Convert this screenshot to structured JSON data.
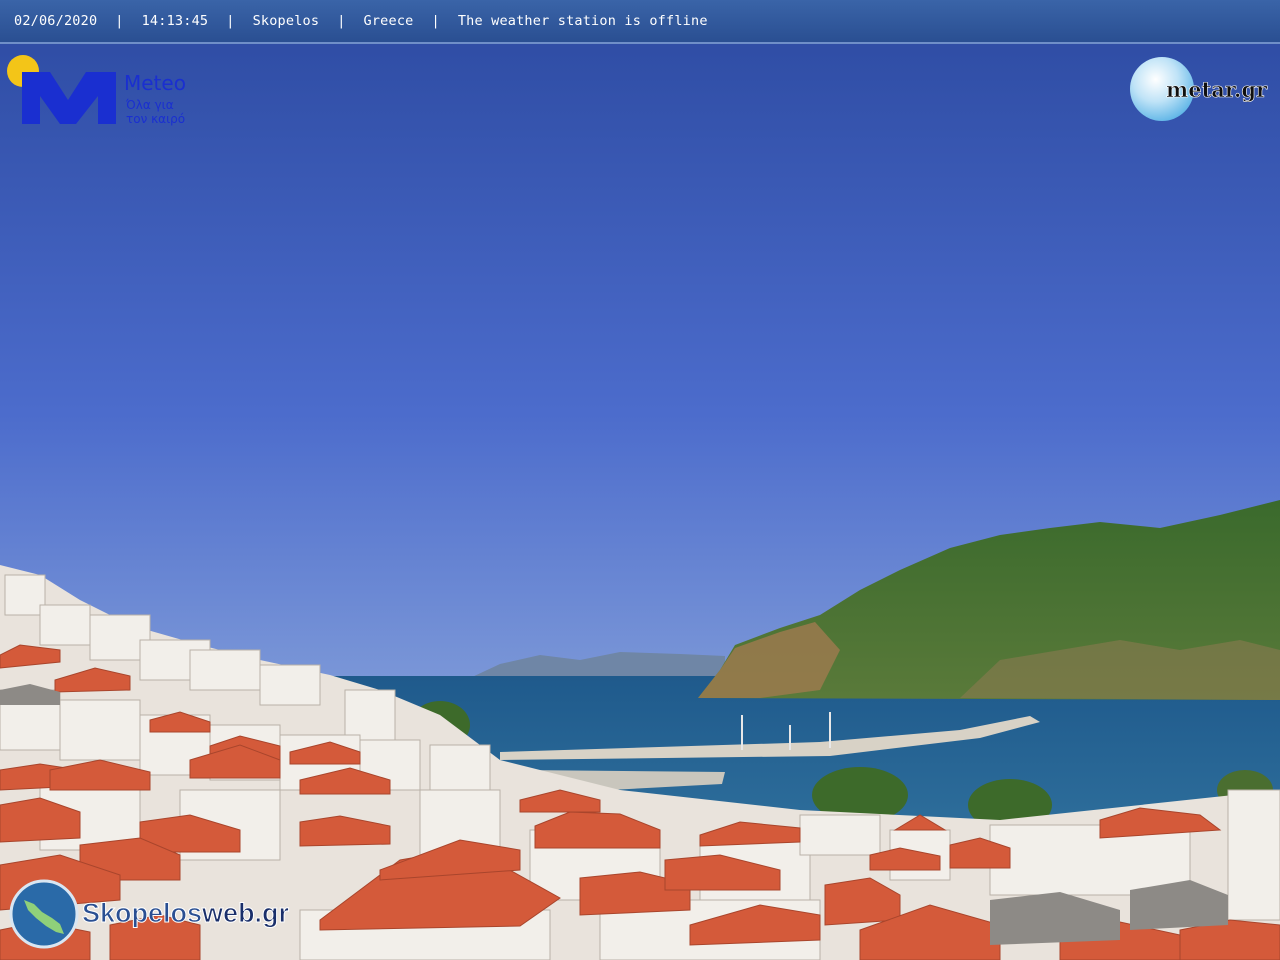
{
  "status_bar": {
    "date": "02/06/2020",
    "time": "14:13:45",
    "place": "Skopelos",
    "country": "Greece",
    "message": "The weather station is offline",
    "separator": "|"
  },
  "logos": {
    "meteo_brand": "Meteo",
    "meteo_tagline_1": "Όλα για",
    "meteo_tagline_2": "τον καιρό",
    "metar_brand": "metar.gr",
    "skopelos_brand_1": "Skopelos",
    "skopelos_brand_2": "web.gr"
  },
  "colors": {
    "sky_top": "#2f4fa6",
    "sky_bottom": "#6f8fd8",
    "sea": "#2c6a9a",
    "hill": "#3f6e2e",
    "roof": "#d45a3a",
    "meteo_blue": "#1a2fd0",
    "sun_yellow": "#f3c518"
  }
}
